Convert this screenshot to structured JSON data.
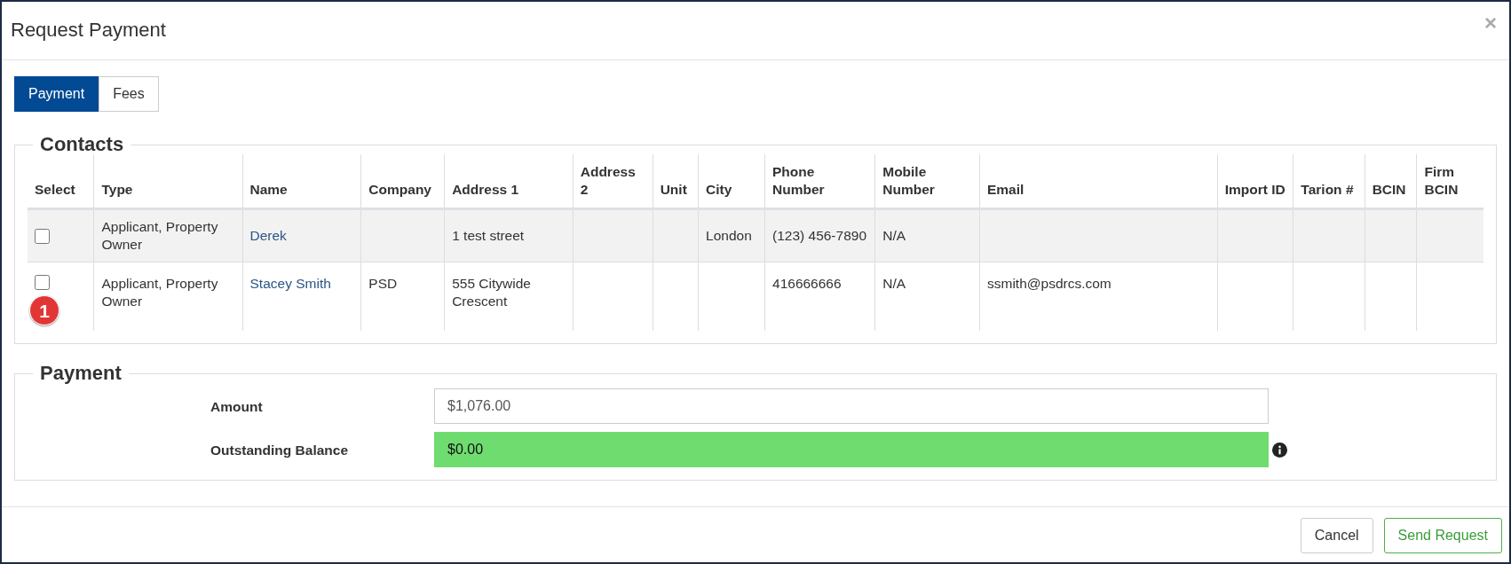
{
  "window": {
    "title": "Request Payment",
    "close": "×"
  },
  "tabs": [
    {
      "label": "Payment",
      "selected": true
    },
    {
      "label": "Fees",
      "selected": false
    }
  ],
  "contacts": {
    "legend": "Contacts",
    "columns": [
      "Select",
      "Type",
      "Name",
      "Company",
      "Address 1",
      "Address 2",
      "Unit",
      "City",
      "Phone Number",
      "Mobile Number",
      "Email",
      "Import ID",
      "Tarion #",
      "BCIN",
      "Firm BCIN"
    ],
    "rows": [
      {
        "checked": false,
        "type": "Applicant, Property Owner",
        "name": "Derek",
        "company": "",
        "address_1": "1 test street",
        "address_2": "",
        "unit": "",
        "city": "London",
        "phone": "(123) 456-7890",
        "mobile": "N/A",
        "email": "",
        "import_id": "",
        "tarion": "",
        "bcin": "",
        "firm_bcin": ""
      },
      {
        "checked": false,
        "type": "Applicant, Property Owner",
        "name": "Stacey Smith",
        "company": "PSD",
        "address_1": "555 Citywide Crescent",
        "address_2": "",
        "unit": "",
        "city": "",
        "phone": "416666666",
        "mobile": "N/A",
        "email": "ssmith@psdrcs.com",
        "import_id": "",
        "tarion": "",
        "bcin": "",
        "firm_bcin": "",
        "marker": "1"
      }
    ]
  },
  "payment": {
    "legend": "Payment",
    "fields": [
      {
        "label": "Amount",
        "value": "$1,076.00",
        "highlighted": false
      },
      {
        "label": "Outstanding Balance",
        "value": "$0.00",
        "highlighted": true,
        "info": true
      }
    ]
  },
  "buttons": [
    {
      "label": "Cancel",
      "kind": "default"
    },
    {
      "label": "Send Request",
      "kind": "success"
    }
  ]
}
